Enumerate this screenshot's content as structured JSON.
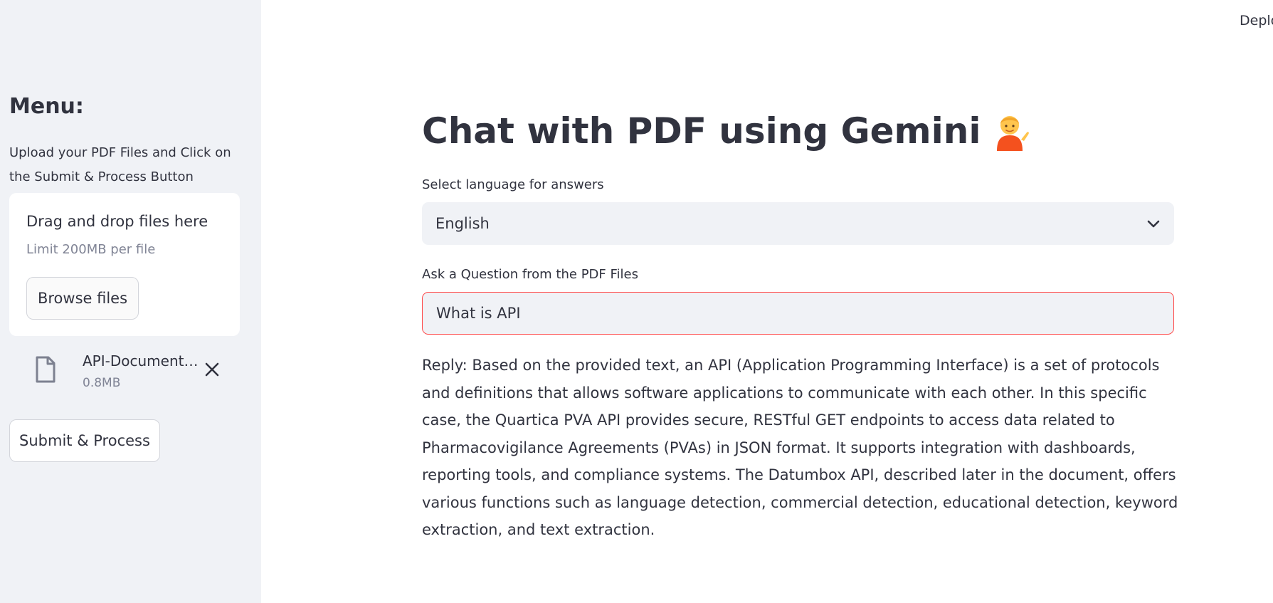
{
  "sidebar": {
    "title": "Menu:",
    "subtitle": "Upload your PDF Files and Click on the Submit & Process Button",
    "uploader": {
      "drop_text": "Drag and drop files here",
      "limit_text": "Limit 200MB per file",
      "browse_label": "Browse files"
    },
    "file": {
      "name": "API-Documentation.pdf",
      "size": "0.8MB",
      "icon": "file-icon",
      "remove_icon": "close-icon"
    },
    "submit_label": "Submit & Process"
  },
  "header": {
    "deploy_label": "Deploy"
  },
  "main": {
    "title": "Chat with PDF using Gemini",
    "title_icon": "person-tipping-hand-emoji",
    "language_label": "Select language for answers",
    "language_value": "English",
    "question_label": "Ask a Question from the PDF Files",
    "question_value": "What is API",
    "reply": "Reply: Based on the provided text, an API (Application Programming Interface) is a set of protocols and definitions that allows software applications to communicate with each other. In this specific case, the Quartica PVA API provides secure, RESTful GET endpoints to access data related to Pharmacovigilance Agreements (PVAs) in JSON format. It supports integration with dashboards, reporting tools, and compliance systems. The Datumbox API, described later in the document, offers various functions such as language detection, commercial detection, educational detection, keyword extraction, and text extraction."
  },
  "colors": {
    "sidebar_bg": "#f0f2f6",
    "text": "#31333f",
    "muted": "#808495",
    "accent_error_border": "#ff4b4b"
  }
}
